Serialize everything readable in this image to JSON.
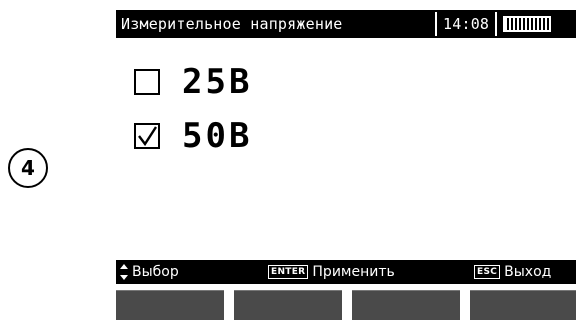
{
  "step_marker": "4",
  "header": {
    "title": "Измерительное напряжение",
    "time": "14:08",
    "battery_icon": "battery-full-icon"
  },
  "options": [
    {
      "label": "25В",
      "checked": false
    },
    {
      "label": "50В",
      "checked": true
    }
  ],
  "footer": {
    "select_icon": "up-down-arrows-icon",
    "select_label": "Выбор",
    "apply_key": "ENTER",
    "apply_label": "Применить",
    "exit_key": "ESC",
    "exit_label": "Выход"
  },
  "colors": {
    "screen_bg": "#ffffff",
    "bar_bg": "#000000",
    "softkey": "#4a4a4a"
  }
}
